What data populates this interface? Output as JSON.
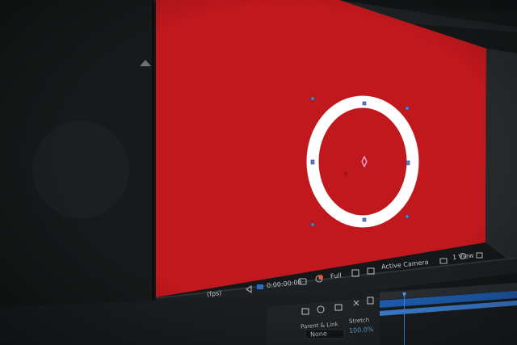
{
  "composition": {
    "background_color": "#c0181d",
    "shape": {
      "type": "ring",
      "stroke_color": "#ffffff"
    }
  },
  "viewer_toolbar": {
    "zoom_menu": "(fps)",
    "timecode": "0:00:00:08",
    "resolution": "Full",
    "view_menu": "Active Camera",
    "views_menu": "1 View"
  },
  "properties": {
    "header": "Parent & Link",
    "parent_value": "None",
    "stretch_header": "Stretch",
    "stretch_value": "100.0%"
  },
  "icons": [
    "snapshot-icon",
    "channel-icon",
    "grid-icon",
    "region-icon",
    "camera-icon",
    "3d-renderer-icon",
    "motion-blur-icon",
    "draft-icon",
    "graph-editor-icon",
    "timeline-tool-icon"
  ]
}
